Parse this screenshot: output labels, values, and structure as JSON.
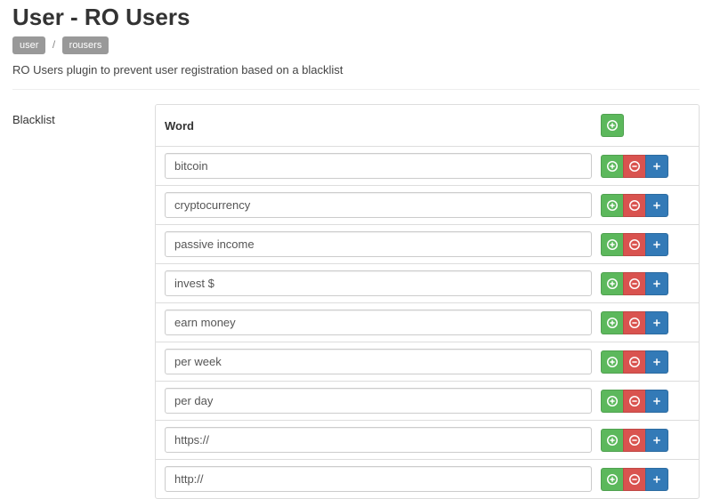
{
  "title": "User - RO Users",
  "breadcrumb": [
    "user",
    "rousers"
  ],
  "breadcrumb_sep": "/",
  "description": "RO Users plugin to prevent user registration based on a blacklist",
  "field_label": "Blacklist",
  "table_header": "Word",
  "words": [
    "bitcoin",
    "cryptocurrency",
    "passive income",
    "invest $",
    "earn money",
    "per week",
    "per day",
    "https://",
    "http://"
  ],
  "icons": {
    "add": "plus-circle",
    "remove": "minus-circle",
    "move": "plus"
  }
}
